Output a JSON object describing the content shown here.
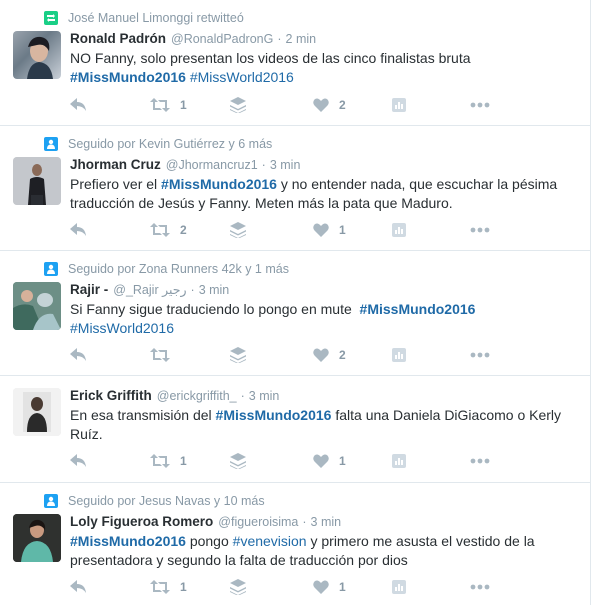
{
  "colors": {
    "accent": "#1f6aa7",
    "muted": "#8899a6",
    "icon": "#aab8c2",
    "retweet_context": "#19cf86",
    "follow_context": "#1da1f2"
  },
  "tweets": [
    {
      "context": {
        "icon": "retweet-context-icon",
        "text": "José Manuel Limonggi retwitteó"
      },
      "fullname": "Ronald Padrón",
      "username": "@RonaldPadronG",
      "separator": "·",
      "time": "2 min",
      "text_parts": [
        "NO Fanny, solo presentan los videos de las cinco finalistas bruta",
        "#MissMundo2016",
        " ",
        "#MissWorld2016"
      ],
      "retweets": "1",
      "likes": "2"
    },
    {
      "context": {
        "icon": "follow-context-icon",
        "text": "Seguido por Kevin Gutiérrez y 6 más"
      },
      "fullname": "Jhorman Cruz",
      "username": "@Jhormancruz1",
      "separator": "·",
      "time": "3 min",
      "text_parts": [
        "Prefiero ver el ",
        "#MissMundo2016",
        " y no entender nada, que escuchar la pésima traducción de Jesús y Fanny. Meten más la pata que Maduro."
      ],
      "retweets": "2",
      "likes": "1"
    },
    {
      "context": {
        "icon": "follow-context-icon",
        "text": "Seguido por Zona Runners 42k y 1 más"
      },
      "fullname": "Rajir -",
      "username": "@_Rajir رجير",
      "separator": "·",
      "time": "3 min",
      "text_parts": [
        "Si Fanny sigue traduciendo lo pongo en mute  ",
        "#MissMundo2016",
        "#MissWorld2016"
      ],
      "retweets": "",
      "likes": "2"
    },
    {
      "context": null,
      "fullname": "Erick Griffith",
      "username": "@erickgriffith_",
      "separator": "·",
      "time": "3 min",
      "text_parts": [
        "En esa transmisión del ",
        "#MissMundo2016",
        " falta una Daniela DiGiacomo o Kerly Ruíz."
      ],
      "retweets": "1",
      "likes": "1"
    },
    {
      "context": {
        "icon": "follow-context-icon",
        "text": "Seguido por Jesus Navas y 10 más"
      },
      "fullname": "Loly Figueroa Romero",
      "username": "@figueroisima",
      "separator": "·",
      "time": "3 min",
      "text_parts": [
        "#MissMundo2016",
        " pongo ",
        "#venevision",
        " y primero me asusta el vestido de la presentadora y segundo la falta de traducción por dios"
      ],
      "retweets": "1",
      "likes": "1"
    }
  ]
}
